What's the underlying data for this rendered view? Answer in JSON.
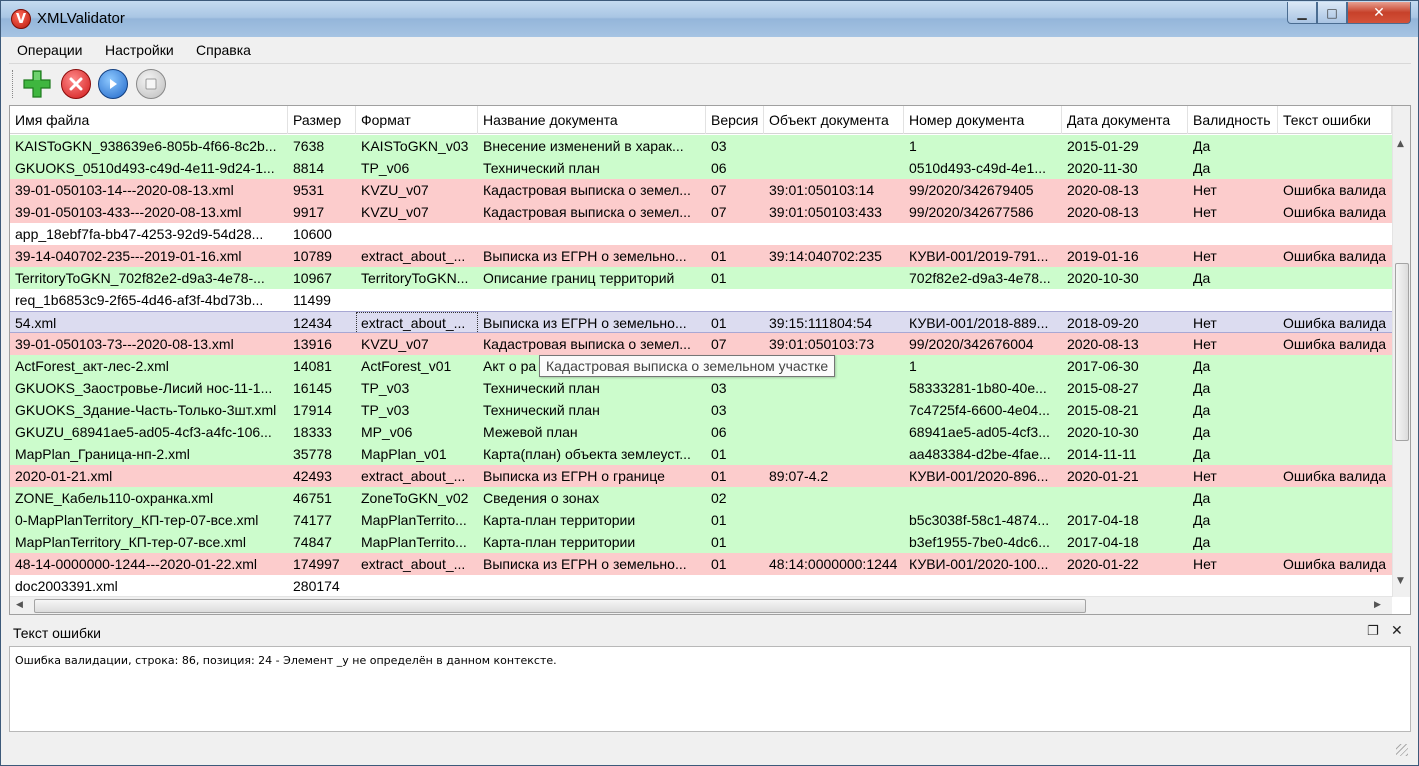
{
  "window": {
    "title": "XMLValidator",
    "logo_letter": "V",
    "min_glyph": "▁",
    "max_glyph": "□",
    "close_glyph": "✕"
  },
  "menu": [
    "Операции",
    "Настройки",
    "Справка"
  ],
  "toolbar": {
    "icons": [
      "add-icon",
      "delete-icon",
      "run-icon",
      "stop-icon"
    ]
  },
  "table": {
    "columns": [
      "Имя файла",
      "Размер",
      "Формат",
      "Название документа",
      "Версия",
      "Объект документа",
      "Номер документа",
      "Дата документа",
      "Валидность",
      "Текст ошибки"
    ],
    "rows": [
      {
        "status": "ok",
        "cells": [
          "KAISToGKN_938639e6-805b-4f66-8c2b...",
          "7638",
          "KAISToGKN_v03",
          "Внесение изменений в харак...",
          "03",
          "",
          "1",
          "2015-01-29",
          "Да",
          ""
        ]
      },
      {
        "status": "ok",
        "cells": [
          "GKUOKS_0510d493-c49d-4e11-9d24-1...",
          "8814",
          "TP_v06",
          "Технический план",
          "06",
          "",
          "0510d493-c49d-4e1...",
          "2020-11-30",
          "Да",
          ""
        ]
      },
      {
        "status": "err",
        "cells": [
          "39-01-050103-14---2020-08-13.xml",
          "9531",
          "KVZU_v07",
          "Кадастровая выписка о земел...",
          "07",
          "39:01:050103:14",
          "99/2020/342679405",
          "2020-08-13",
          "Нет",
          "Ошибка валида"
        ]
      },
      {
        "status": "err",
        "cells": [
          "39-01-050103-433---2020-08-13.xml",
          "9917",
          "KVZU_v07",
          "Кадастровая выписка о земел...",
          "07",
          "39:01:050103:433",
          "99/2020/342677586",
          "2020-08-13",
          "Нет",
          "Ошибка валида"
        ]
      },
      {
        "status": "none",
        "cells": [
          "app_18ebf7fa-bb47-4253-92d9-54d28...",
          "10600",
          "",
          "",
          "",
          "",
          "",
          "",
          "",
          ""
        ]
      },
      {
        "status": "err",
        "cells": [
          "39-14-040702-235---2019-01-16.xml",
          "10789",
          "extract_about_...",
          "Выписка из ЕГРН о земельно...",
          "01",
          "39:14:040702:235",
          "КУВИ-001/2019-791...",
          "2019-01-16",
          "Нет",
          "Ошибка валида"
        ]
      },
      {
        "status": "ok",
        "cells": [
          "TerritoryToGKN_702f82e2-d9a3-4e78-...",
          "10967",
          "TerritoryToGKN...",
          "Описание границ территорий",
          "01",
          "",
          "702f82e2-d9a3-4e78...",
          "2020-10-30",
          "Да",
          ""
        ]
      },
      {
        "status": "none",
        "cells": [
          "req_1b6853c9-2f65-4d46-af3f-4bd73b...",
          "11499",
          "",
          "",
          "",
          "",
          "",
          "",
          "",
          ""
        ]
      },
      {
        "status": "selected",
        "cells": [
          "54.xml",
          "12434",
          "extract_about_...",
          "Выписка из ЕГРН о земельно...",
          "01",
          "39:15:111804:54",
          "КУВИ-001/2018-889...",
          "2018-09-20",
          "Нет",
          "Ошибка валида"
        ]
      },
      {
        "status": "err",
        "cells": [
          "39-01-050103-73---2020-08-13.xml",
          "13916",
          "KVZU_v07",
          "Кадастровая выписка о земел...",
          "07",
          "39:01:050103:73",
          "99/2020/342676004",
          "2020-08-13",
          "Нет",
          "Ошибка валида"
        ]
      },
      {
        "status": "ok",
        "cells": [
          "ActForest_акт-лес-2.xml",
          "14081",
          "ActForest_v01",
          "Акт о ра",
          "",
          "",
          "1",
          "2017-06-30",
          "Да",
          ""
        ]
      },
      {
        "status": "ok",
        "cells": [
          "GKUOKS_Заостровье-Лисий нос-11-1...",
          "16145",
          "TP_v03",
          "Технический план",
          "03",
          "",
          "58333281-1b80-40e...",
          "2015-08-27",
          "Да",
          ""
        ]
      },
      {
        "status": "ok",
        "cells": [
          "GKUOKS_Здание-Часть-Только-3шт.xml",
          "17914",
          "TP_v03",
          "Технический план",
          "03",
          "",
          "7c4725f4-6600-4e04...",
          "2015-08-21",
          "Да",
          ""
        ]
      },
      {
        "status": "ok",
        "cells": [
          "GKUZU_68941ae5-ad05-4cf3-a4fc-106...",
          "18333",
          "MP_v06",
          "Межевой план",
          "06",
          "",
          "68941ae5-ad05-4cf3...",
          "2020-10-30",
          "Да",
          ""
        ]
      },
      {
        "status": "ok",
        "cells": [
          "MapPlan_Граница-нп-2.xml",
          "35778",
          "MapPlan_v01",
          "Карта(план) объекта землеуст...",
          "01",
          "",
          "aa483384-d2be-4fae...",
          "2014-11-11",
          "Да",
          ""
        ]
      },
      {
        "status": "err",
        "cells": [
          "2020-01-21.xml",
          "42493",
          "extract_about_...",
          "Выписка из ЕГРН о границе",
          "01",
          "89:07-4.2",
          "КУВИ-001/2020-896...",
          "2020-01-21",
          "Нет",
          "Ошибка валида"
        ]
      },
      {
        "status": "ok",
        "cells": [
          "ZONE_Кабель110-охранка.xml",
          "46751",
          "ZoneToGKN_v02",
          "Сведения о зонах",
          "02",
          "",
          "",
          "",
          "Да",
          ""
        ]
      },
      {
        "status": "ok",
        "cells": [
          "0-MapPlanTerritory_КП-тер-07-все.xml",
          "74177",
          "MapPlanTerrito...",
          "Карта-план территории",
          "01",
          "",
          "b5c3038f-58c1-4874...",
          "2017-04-18",
          "Да",
          ""
        ]
      },
      {
        "status": "ok",
        "cells": [
          "MapPlanTerritory_КП-тер-07-все.xml",
          "74847",
          "MapPlanTerrito...",
          "Карта-план территории",
          "01",
          "",
          "b3ef1955-7be0-4dc6...",
          "2017-04-18",
          "Да",
          ""
        ]
      },
      {
        "status": "err",
        "cells": [
          "48-14-0000000-1244---2020-01-22.xml",
          "174997",
          "extract_about_...",
          "Выписка из ЕГРН о земельно...",
          "01",
          "48:14:0000000:1244",
          "КУВИ-001/2020-100...",
          "2020-01-22",
          "Нет",
          "Ошибка валида"
        ]
      },
      {
        "status": "none",
        "cells": [
          "doc2003391.xml",
          "280174",
          "",
          "",
          "",
          "",
          "",
          "",
          "",
          ""
        ]
      }
    ]
  },
  "tooltip": "Кадастровая выписка о земельном участке",
  "error_panel": {
    "title": "Текст ошибки",
    "text": "Ошибка валидации, строка: 86, позиция: 24 - Элемент _у не определён в данном контексте."
  },
  "colors": {
    "ok_row": "#ccfccc",
    "error_row": "#fccccc",
    "selected_row": "#dcdcf0"
  }
}
